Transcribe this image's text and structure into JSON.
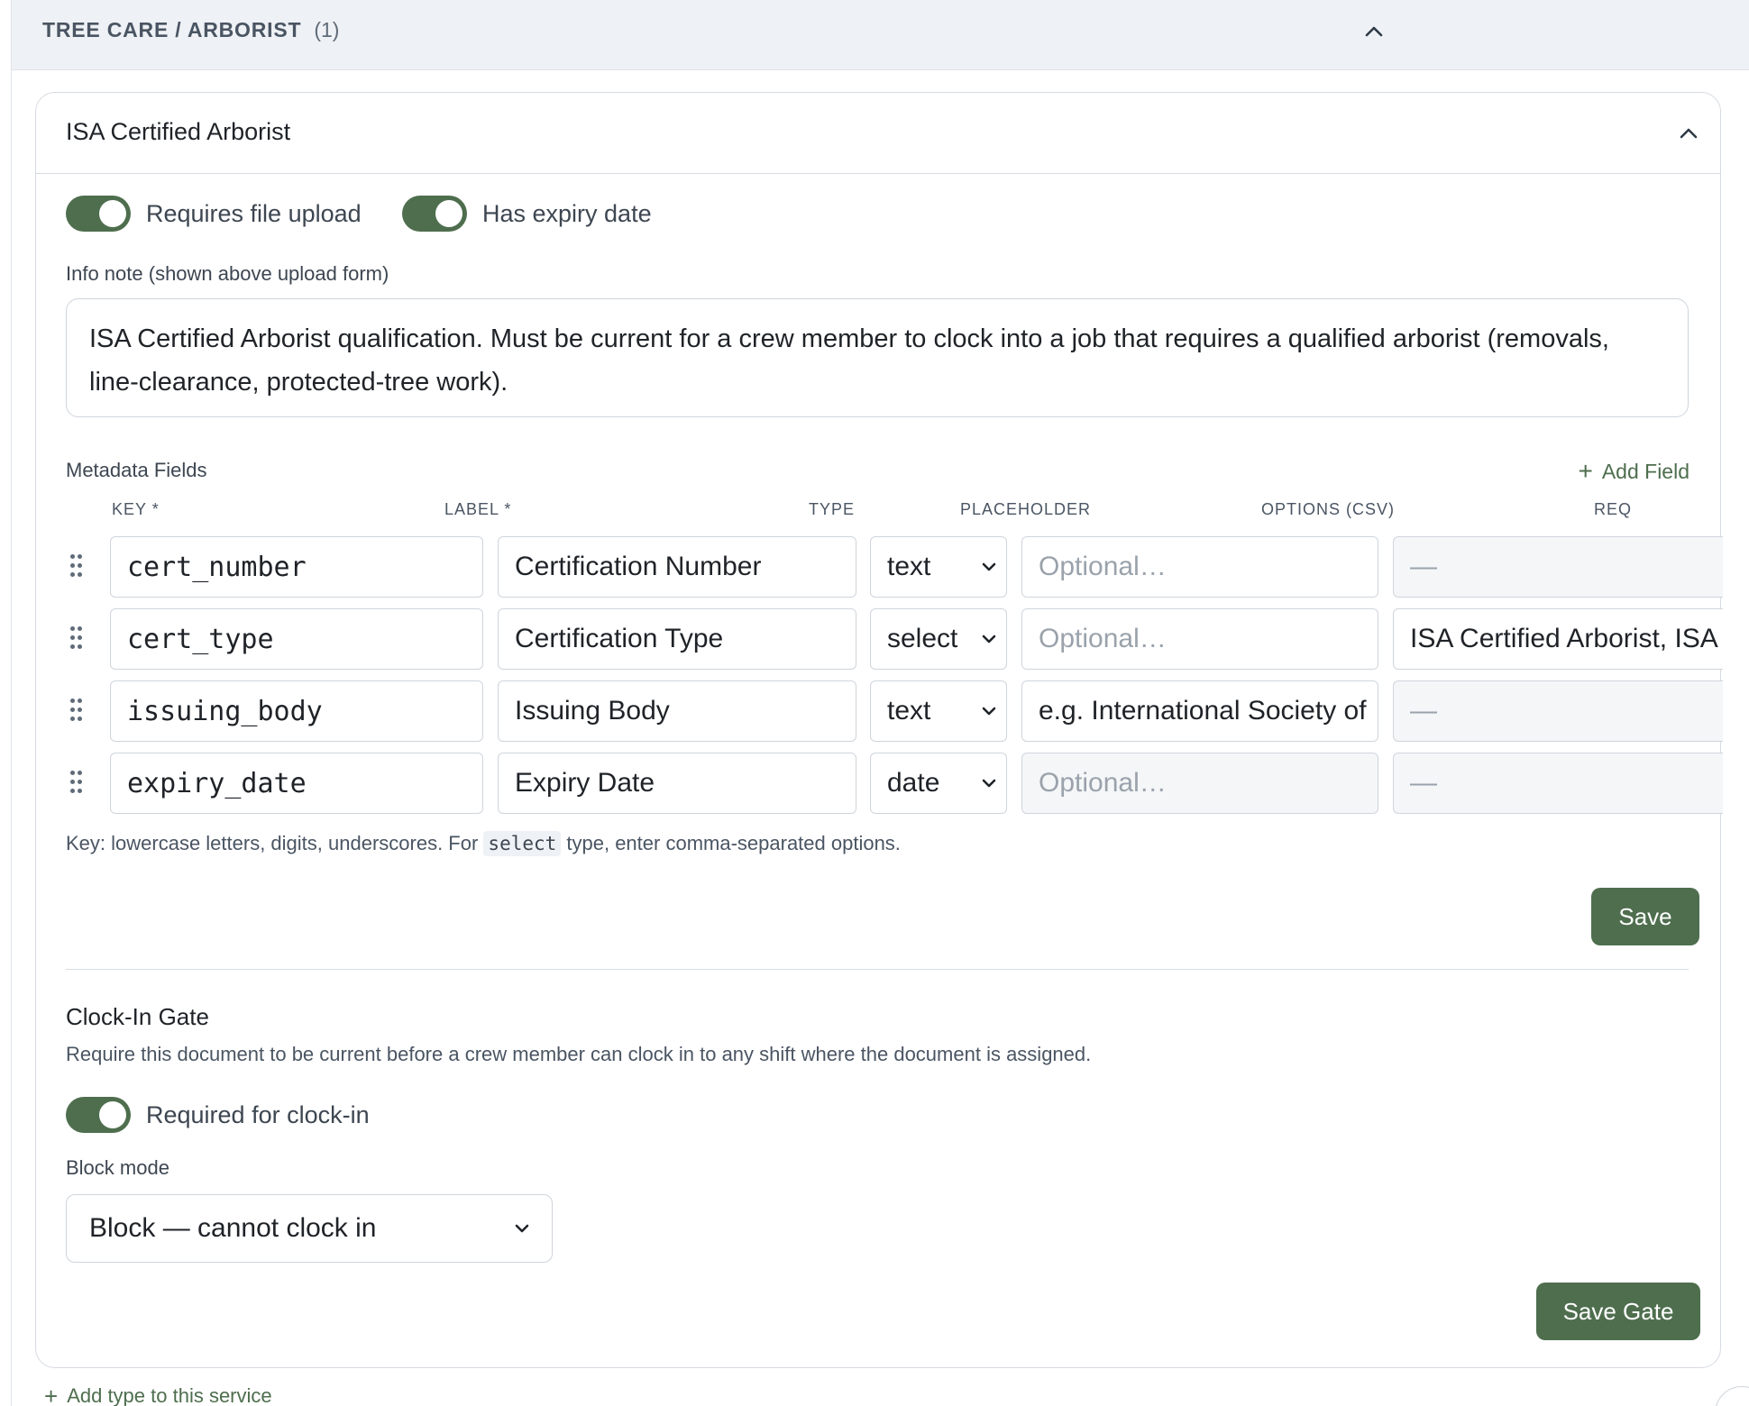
{
  "section": {
    "title": "TREE CARE / ARBORIST",
    "count": "(1)"
  },
  "card": {
    "title": "ISA Certified Arborist",
    "toggles": {
      "requires_file_upload": {
        "label": "Requires file upload",
        "on": true
      },
      "has_expiry_date": {
        "label": "Has expiry date",
        "on": true
      }
    },
    "info_note": {
      "label": "Info note (shown above upload form)",
      "value": "ISA Certified Arborist qualification. Must be current for a crew member to clock into a job that requires a qualified arborist (removals, line-clearance, protected-tree work)."
    },
    "metadata": {
      "title": "Metadata Fields",
      "add_field_label": "Add Field",
      "columns": [
        "KEY *",
        "LABEL *",
        "TYPE",
        "PLACEHOLDER",
        "OPTIONS (CSV)",
        "REQ"
      ],
      "rows": [
        {
          "key": "cert_number",
          "label": "Certification Number",
          "type": "text",
          "placeholder": "Optional…",
          "placeholder_is_hint": true,
          "options": "—",
          "options_disabled": true
        },
        {
          "key": "cert_type",
          "label": "Certification Type",
          "type": "select",
          "placeholder": "Optional…",
          "placeholder_is_hint": true,
          "options": "ISA Certified Arborist, ISA C",
          "options_disabled": false
        },
        {
          "key": "issuing_body",
          "label": "Issuing Body",
          "type": "text",
          "placeholder": "e.g. International Society of",
          "placeholder_is_hint": false,
          "options": "—",
          "options_disabled": true
        },
        {
          "key": "expiry_date",
          "label": "Expiry Date",
          "type": "date",
          "placeholder": "Optional…",
          "placeholder_is_hint": true,
          "placeholder_disabled": true,
          "options": "—",
          "options_disabled": true
        }
      ],
      "hint_before": "Key: lowercase letters, digits, underscores. For ",
      "hint_code": "select",
      "hint_after": " type, enter comma-separated options.",
      "save_label": "Save"
    },
    "gate": {
      "title": "Clock-In Gate",
      "description": "Require this document to be current before a crew member can clock in to any shift where the document is assigned.",
      "toggle": {
        "label": "Required for clock-in",
        "on": true
      },
      "block_mode_label": "Block mode",
      "block_mode_value": "Block — cannot clock in",
      "save_label": "Save Gate"
    }
  },
  "add_type_label": "Add type to this service",
  "colors": {
    "accent": "#4e6e4e",
    "header_bg": "#eef1f5",
    "border": "#d6dbe1"
  }
}
